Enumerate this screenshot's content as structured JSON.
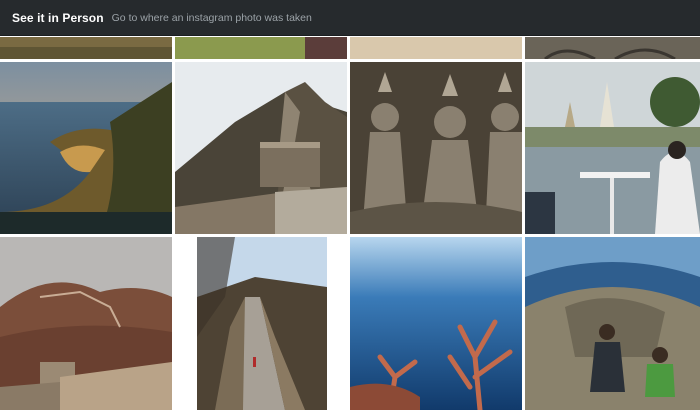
{
  "header": {
    "title": "See it in Person",
    "subtitle": "Go to where an instagram photo was taken"
  },
  "colors": {
    "topbar_bg": "#262a2d",
    "title": "#ffffff",
    "subtitle": "#9ca3a8"
  },
  "photos": [
    {
      "subject": "coastal cliff at sunset"
    },
    {
      "subject": "great wall winding over hills"
    },
    {
      "subject": "stone carved deity relief"
    },
    {
      "subject": "waterfront dining with temple"
    },
    {
      "subject": "great wall at dusk"
    },
    {
      "subject": "great wall path with tourists"
    },
    {
      "subject": "underwater coral reef"
    },
    {
      "subject": "fisheye selfie on rocky coast"
    }
  ]
}
